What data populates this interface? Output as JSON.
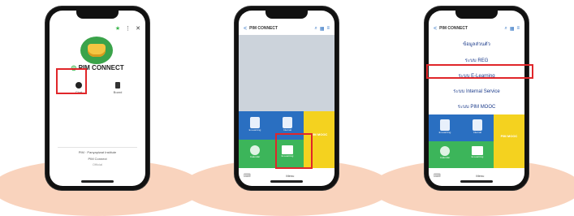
{
  "phone1": {
    "app_name": "PIM CONNECT",
    "brand_mark": "◎",
    "menu_left_label": "Chat",
    "menu_right_label": "Board",
    "footer_line1": "PIM · Panyapiwat Institute",
    "footer_line2": "PIM Connect",
    "footer_line3": "Official",
    "icons": [
      "star-icon",
      "more-icon",
      "close-icon",
      "chat-icon",
      "board-icon"
    ]
  },
  "phone2": {
    "title": "PIM CONNECT",
    "back": "<",
    "tile_labels": [
      "E-Learning",
      "Internal",
      "PIM MOOC",
      "Calendar",
      "E-Learning",
      "Online"
    ],
    "bottom_label": "Menu",
    "colors": {
      "blue": "#2a6fc1",
      "yellow": "#f4d21f",
      "green": "#3cb55a",
      "teal": "#1f9e9e"
    }
  },
  "phone3": {
    "title": "PIM CONNECT",
    "menu": [
      "ข้อมูลส่วนตัว",
      "ระบบ REG",
      "ระบบ E-Learning",
      "ระบบ Internal Service",
      "ระบบ PIM MOOC"
    ],
    "highlighted_index": 2,
    "tile_labels": [
      "E-Learning",
      "Internal",
      "PIM MOOC",
      "Calendar",
      "E-Learning",
      "Online"
    ],
    "bottom_label": "Menu"
  },
  "colors": {
    "highlight": "#e0262a",
    "shadow": "#f9d3bd",
    "phone": "#111111",
    "link_blue": "#1a3a8a"
  }
}
